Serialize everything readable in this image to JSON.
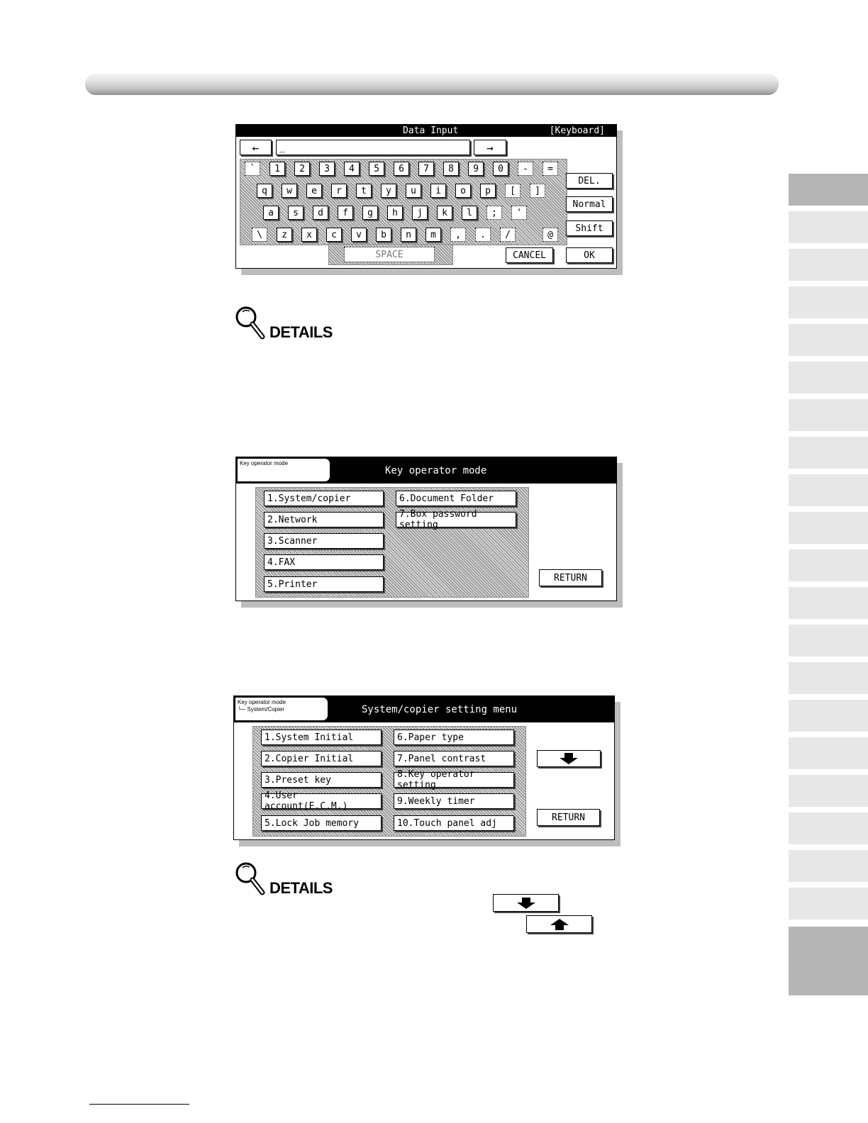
{
  "details_label": "DETAILS",
  "keyboard": {
    "title": "Data Input",
    "mode": "[Keyboard]",
    "left_arrow": "←",
    "right_arrow": "→",
    "cursor": "_",
    "row1": [
      "`",
      "1",
      "2",
      "3",
      "4",
      "5",
      "6",
      "7",
      "8",
      "9",
      "0",
      "-",
      "="
    ],
    "row2": [
      "q",
      "w",
      "e",
      "r",
      "t",
      "y",
      "u",
      "i",
      "o",
      "p",
      "[",
      "]"
    ],
    "row3": [
      "a",
      "s",
      "d",
      "f",
      "g",
      "h",
      "j",
      "k",
      "l",
      ";",
      "'"
    ],
    "row4": [
      "\\",
      "z",
      "x",
      "c",
      "v",
      "b",
      "n",
      "m",
      ",",
      ".",
      "/",
      "@"
    ],
    "space": "SPACE",
    "del": "DEL.",
    "normal": "Normal",
    "shift": "Shift",
    "cancel": "CANCEL",
    "ok": "OK"
  },
  "key_operator": {
    "breadcrumb": "Key operator mode",
    "title": "Key operator mode",
    "items": [
      "1.System/copier",
      "2.Network",
      "3.Scanner",
      "4.FAX",
      "5.Printer",
      "6.Document Folder",
      "7.Box password setting"
    ],
    "return": "RETURN"
  },
  "system_copier": {
    "breadcrumb_1": "Key operator mode",
    "breadcrumb_2": "└─ System/Copier",
    "title": "System/copier setting menu",
    "items": [
      "1.System Initial",
      "2.Copier Initial",
      "3.Preset key",
      "4.User account(E.C.M.)",
      "5.Lock Job memory",
      "6.Paper type",
      "7.Panel contrast",
      "8.Key operator setting",
      "9.Weekly timer",
      "10.Touch panel adj"
    ],
    "return": "RETURN"
  }
}
